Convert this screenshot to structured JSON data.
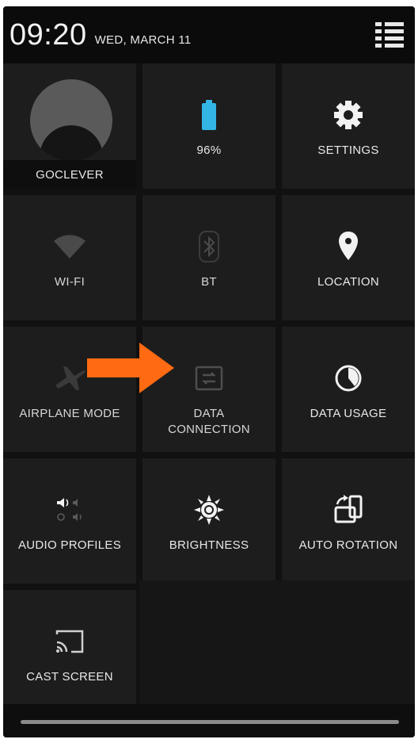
{
  "status_bar": {
    "time": "09:20",
    "date": "WED, MARCH 11"
  },
  "user": {
    "name": "GOCLEVER"
  },
  "tiles": {
    "battery": {
      "label": "96%",
      "icon": "battery-icon",
      "color": "#33b5e5"
    },
    "settings": {
      "label": "SETTINGS",
      "icon": "gear-icon"
    },
    "wifi": {
      "label": "WI-FI",
      "icon": "wifi-icon"
    },
    "bt": {
      "label": "BT",
      "icon": "bluetooth-icon"
    },
    "location": {
      "label": "LOCATION",
      "icon": "location-pin-icon"
    },
    "airplane": {
      "label": "AIRPLANE MODE",
      "icon": "airplane-icon"
    },
    "data_connection": {
      "label_line1": "DATA",
      "label_line2": "CONNECTION",
      "icon": "data-connection-icon"
    },
    "data_usage": {
      "label": "DATA USAGE",
      "icon": "pie-chart-icon"
    },
    "audio_profiles": {
      "label": "AUDIO PROFILES",
      "icon": "audio-profiles-icon"
    },
    "brightness": {
      "label": "BRIGHTNESS",
      "icon": "sun-icon"
    },
    "auto_rotation": {
      "label": "AUTO ROTATION",
      "icon": "rotate-icon"
    },
    "cast_screen": {
      "label": "CAST SCREEN",
      "icon": "cast-icon"
    }
  },
  "annotation": {
    "arrow_color": "#ff6a13"
  }
}
